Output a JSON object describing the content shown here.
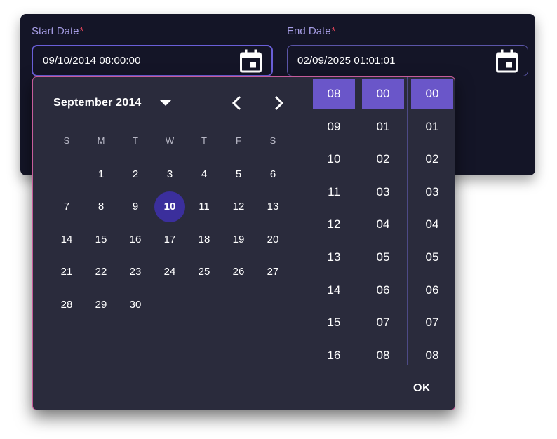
{
  "start": {
    "label": "Start Date",
    "required_mark": "*",
    "value": "09/10/2014 08:00:00"
  },
  "end": {
    "label": "End Date",
    "required_mark": "*",
    "value": "02/09/2025 01:01:01"
  },
  "calendar": {
    "month_label": "September 2014",
    "weekdays": [
      "S",
      "M",
      "T",
      "W",
      "T",
      "F",
      "S"
    ],
    "days": [
      "1",
      "2",
      "3",
      "4",
      "5",
      "6",
      "7",
      "8",
      "9",
      "10",
      "11",
      "12",
      "13",
      "14",
      "15",
      "16",
      "17",
      "18",
      "19",
      "20",
      "21",
      "22",
      "23",
      "24",
      "25",
      "26",
      "27",
      "28",
      "29",
      "30"
    ],
    "selected_day": "10",
    "first_weekday_index": 1
  },
  "time": {
    "hours": [
      "08",
      "09",
      "10",
      "11",
      "12",
      "13",
      "14",
      "15",
      "16"
    ],
    "minutes": [
      "00",
      "01",
      "02",
      "03",
      "04",
      "05",
      "06",
      "07",
      "08"
    ],
    "seconds": [
      "00",
      "01",
      "02",
      "03",
      "04",
      "05",
      "06",
      "07",
      "08"
    ]
  },
  "ok_label": "OK",
  "colors": {
    "accent": "#6a56c9",
    "selected_day": "#3b2f9c",
    "required": "#e5455a",
    "label": "#a79ee6"
  },
  "icons": [
    "calendar-icon",
    "dropdown-caret-icon",
    "chevron-left-icon",
    "chevron-right-icon"
  ]
}
